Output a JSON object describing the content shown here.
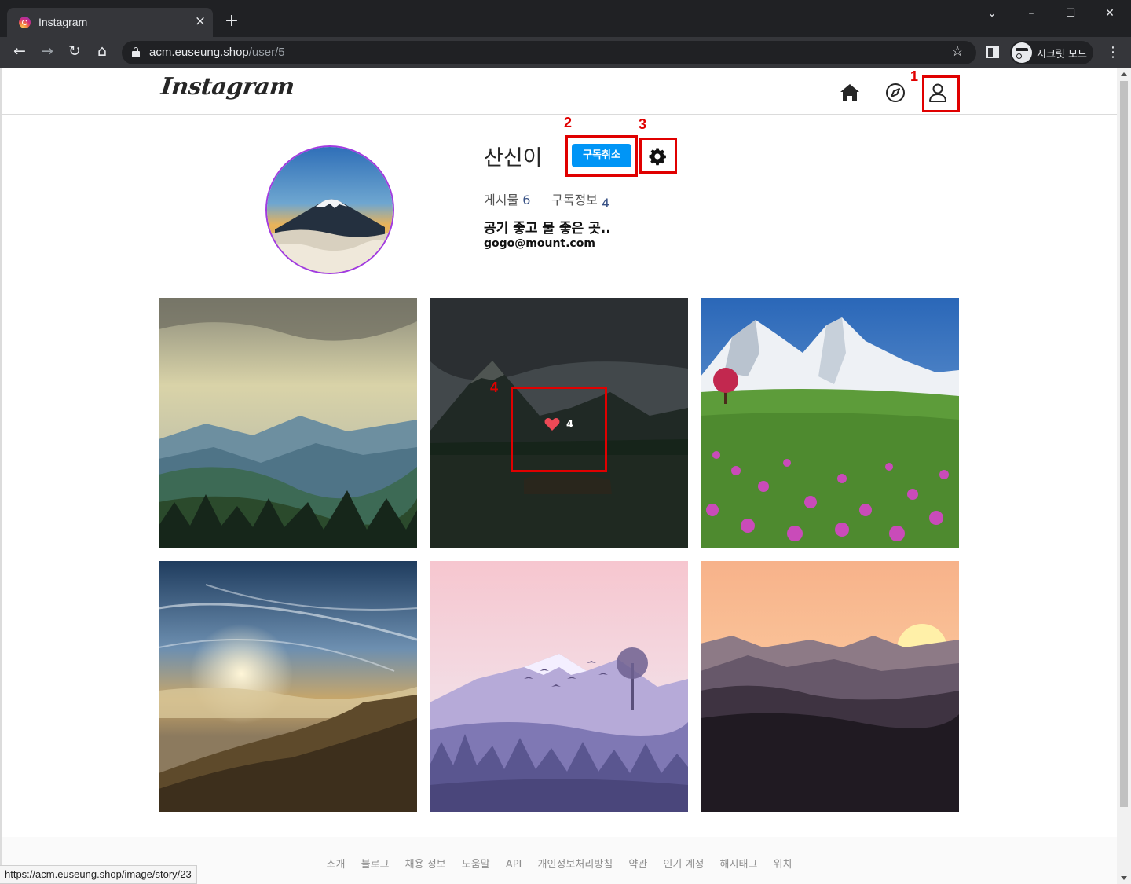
{
  "browser": {
    "tab_title": "Instagram",
    "tab_close": "×",
    "new_tab": "+",
    "url_host": "acm.euseung.shop",
    "url_path": "/user/5",
    "incognito_label": "시크릿 모드",
    "window_controls": [
      "⌄",
      "–",
      "☐",
      "✕"
    ]
  },
  "site": {
    "logo": "Instagram"
  },
  "profile": {
    "name": "산신이",
    "unsubscribe_label": "구독취소",
    "posts_label": "게시물",
    "posts_count": "6",
    "subscriptions_label": "구독정보",
    "subscriptions_count": "4",
    "bio": "공기 좋고 물 좋은 곳..",
    "email": "gogo@mount.com"
  },
  "grid": {
    "hovered_likes": "4",
    "photos": [
      {
        "scene": "mountain-valley-forest"
      },
      {
        "scene": "dark-lake-mountain",
        "hovered": true
      },
      {
        "scene": "snowy-peaks-flower-meadow"
      },
      {
        "scene": "sunset-clouds-ridge"
      },
      {
        "scene": "purple-mountains-birds"
      },
      {
        "scene": "orange-sunset-silhouette"
      }
    ]
  },
  "annotations": [
    "1",
    "2",
    "3",
    "4"
  ],
  "footer": {
    "links": [
      "소개",
      "블로그",
      "채용 정보",
      "도움말",
      "API",
      "개인정보처리방침",
      "약관",
      "인기 계정",
      "해시태그",
      "위치"
    ]
  },
  "status_url": "https://acm.euseung.shop/image/story/23",
  "icons": {
    "tab_favicon": "instagram-favicon",
    "header": [
      "home-icon",
      "explore-compass-icon",
      "profile-user-icon"
    ],
    "settings": "gear-icon",
    "like": "heart-icon"
  },
  "colors": {
    "primary_button": "#0095f6",
    "annotation": "#e00000",
    "avatar_ring": "#a13be0",
    "like_heart": "#ed4956"
  }
}
